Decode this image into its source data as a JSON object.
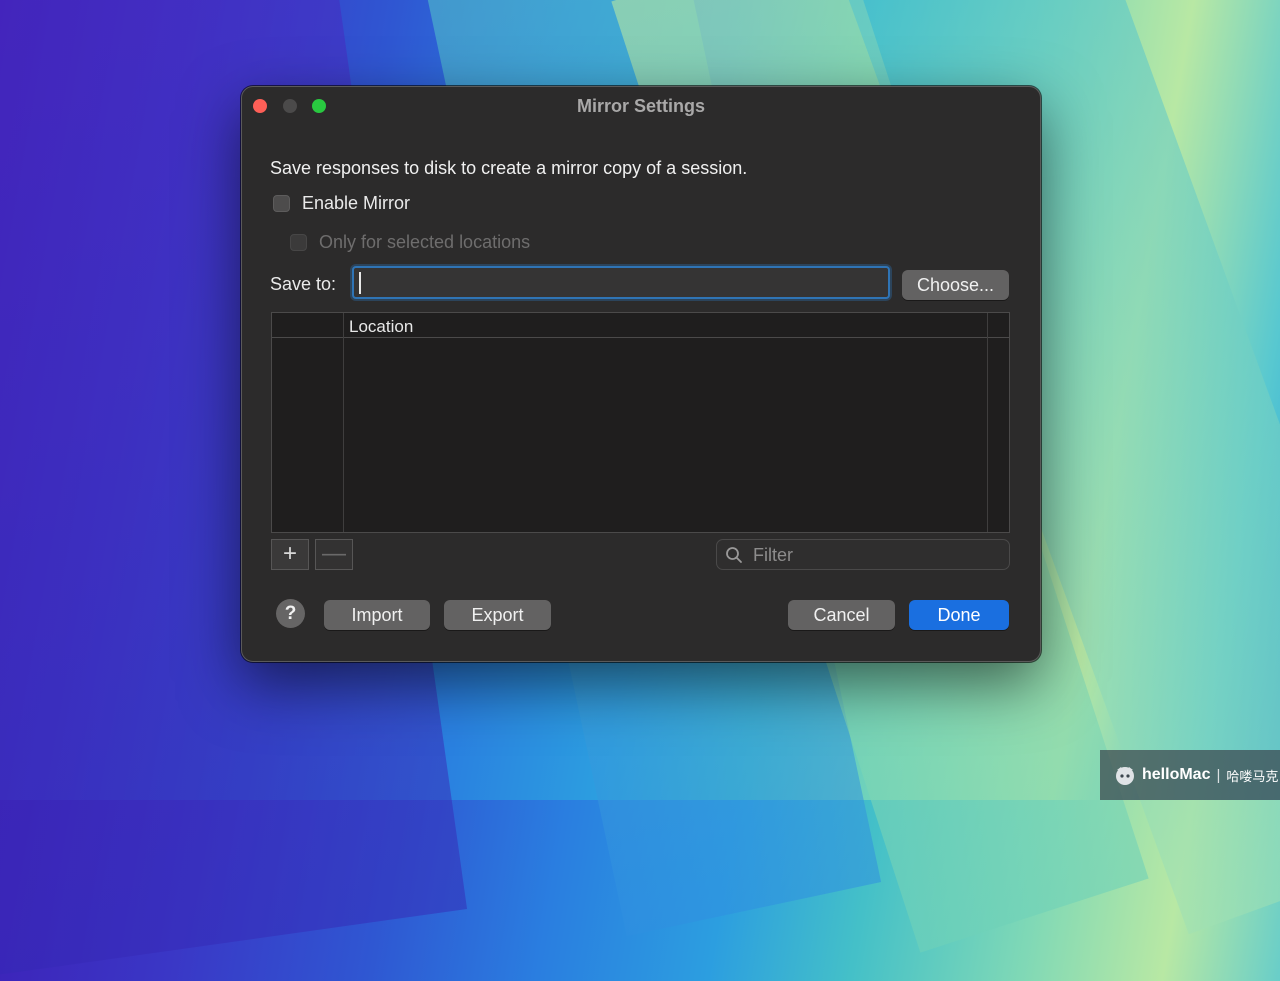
{
  "window": {
    "title": "Mirror Settings",
    "description": "Save responses to disk to create a mirror copy of a session."
  },
  "options": {
    "enable_mirror": {
      "label": "Enable Mirror",
      "checked": false
    },
    "only_selected": {
      "label": "Only for selected locations",
      "checked": false,
      "disabled": true
    }
  },
  "save_to": {
    "label": "Save to:",
    "value": "",
    "choose_label": "Choose..."
  },
  "table": {
    "columns": [
      "",
      "Location"
    ],
    "rows": []
  },
  "table_controls": {
    "add_label": "+",
    "remove_label": "—",
    "filter_placeholder": "Filter"
  },
  "footer": {
    "help_label": "?",
    "import_label": "Import",
    "export_label": "Export",
    "cancel_label": "Cancel",
    "done_label": "Done"
  },
  "watermark": {
    "brand": "helloMac",
    "separator": "|",
    "chinese": "哈喽马克"
  },
  "colors": {
    "accent": "#1a6fe0",
    "close": "#fe5f57",
    "maximize": "#29c840",
    "focus_ring": "#2f74b5"
  }
}
